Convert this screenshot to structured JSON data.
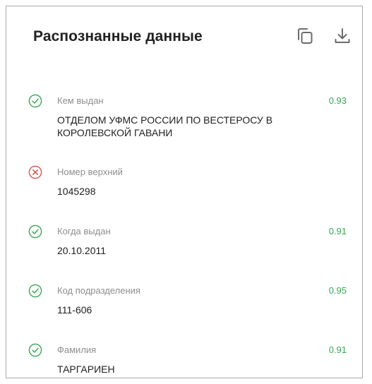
{
  "header": {
    "title": "Распознанные данные",
    "copy_icon": "copy-icon",
    "download_icon": "download-icon"
  },
  "colors": {
    "success": "#3aa757",
    "error": "#d9534f",
    "label": "#8e8e8e",
    "value": "#1f1f1f"
  },
  "fields": [
    {
      "status": "ok",
      "label": "Кем выдан",
      "value_line1": "ОТДЕЛОМ УФМС РОССИИ ПО ВЕСТЕРОСУ В",
      "value_line2": "КОРОЛЕВСКОЙ ГАВАНИ",
      "score": "0.93"
    },
    {
      "status": "error",
      "label": "Номер верхний",
      "value_line1": "1045298",
      "value_line2": "",
      "score": ""
    },
    {
      "status": "ok",
      "label": "Когда выдан",
      "value_line1": "20.10.2011",
      "value_line2": "",
      "score": "0.91"
    },
    {
      "status": "ok",
      "label": "Код подразделения",
      "value_line1": "111-606",
      "value_line2": "",
      "score": "0.95"
    },
    {
      "status": "ok",
      "label": "Фамилия",
      "value_line1": "ТАРГАРИЕН",
      "value_line2": "",
      "score": "0.91"
    }
  ]
}
